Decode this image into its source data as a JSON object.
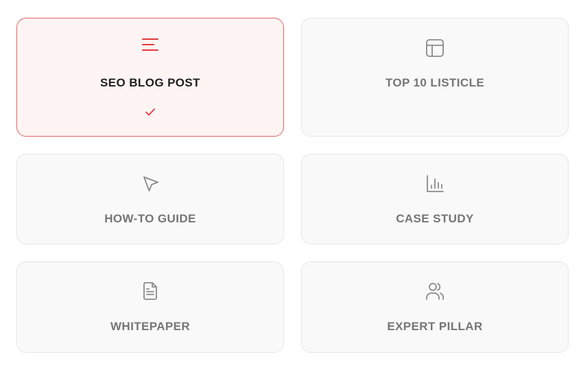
{
  "options": [
    {
      "label": "SEO BLOG POST",
      "icon": "align-left-lines-icon",
      "selected": true,
      "check_icon": "checkmark-icon"
    },
    {
      "label": "TOP 10 LISTICLE",
      "icon": "layout-template-icon",
      "selected": false
    },
    {
      "label": "HOW-TO GUIDE",
      "icon": "cursor-pointer-icon",
      "selected": false
    },
    {
      "label": "CASE STUDY",
      "icon": "bar-chart-icon",
      "selected": false
    },
    {
      "label": "WHITEPAPER",
      "icon": "document-icon",
      "selected": false
    },
    {
      "label": "EXPERT PILLAR",
      "icon": "users-icon",
      "selected": false
    }
  ],
  "colors": {
    "accent": "#e0393a",
    "selected_bg": "#fff4f4",
    "selected_border": "#e26a6a",
    "card_bg": "#f9f9f9",
    "card_border": "#e6e6e6",
    "icon_muted": "#8a8a8a",
    "label_muted": "#757575",
    "label_selected": "#1f1f1f"
  }
}
